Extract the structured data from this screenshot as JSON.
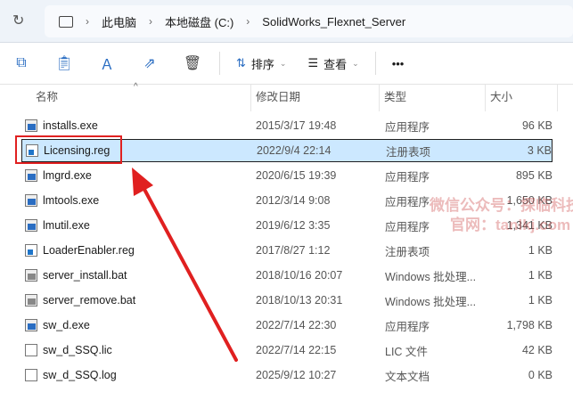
{
  "address": {
    "crumbs": [
      "此电脑",
      "本地磁盘 (C:)",
      "SolidWorks_Flexnet_Server"
    ]
  },
  "toolbar": {
    "sort_label": "排序",
    "view_label": "查看",
    "more_label": "•••"
  },
  "columns": [
    "名称",
    "修改日期",
    "类型",
    "大小"
  ],
  "files": [
    {
      "name": "installs.exe",
      "date": "2015/3/17 19:48",
      "type": "应用程序",
      "size": "96 KB",
      "icon": "exe"
    },
    {
      "name": "Licensing.reg",
      "date": "2022/9/4 22:14",
      "type": "注册表项",
      "size": "3 KB",
      "icon": "reg",
      "selected": true
    },
    {
      "name": "lmgrd.exe",
      "date": "2020/6/15 19:39",
      "type": "应用程序",
      "size": "895 KB",
      "icon": "exe"
    },
    {
      "name": "lmtools.exe",
      "date": "2012/3/14 9:08",
      "type": "应用程序",
      "size": "1,650 KB",
      "icon": "exe"
    },
    {
      "name": "lmutil.exe",
      "date": "2019/6/12 3:35",
      "type": "应用程序",
      "size": "1,341 KB",
      "icon": "exe"
    },
    {
      "name": "LoaderEnabler.reg",
      "date": "2017/8/27 1:12",
      "type": "注册表项",
      "size": "1 KB",
      "icon": "reg"
    },
    {
      "name": "server_install.bat",
      "date": "2018/10/16 20:07",
      "type": "Windows 批处理...",
      "size": "1 KB",
      "icon": "bat"
    },
    {
      "name": "server_remove.bat",
      "date": "2018/10/13 20:31",
      "type": "Windows 批处理...",
      "size": "1 KB",
      "icon": "bat"
    },
    {
      "name": "sw_d.exe",
      "date": "2022/7/14 22:30",
      "type": "应用程序",
      "size": "1,798 KB",
      "icon": "exe"
    },
    {
      "name": "sw_d_SSQ.lic",
      "date": "2022/7/14 22:15",
      "type": "LIC 文件",
      "size": "42 KB",
      "icon": "txt"
    },
    {
      "name": "sw_d_SSQ.log",
      "date": "2025/9/12 10:27",
      "type": "文本文档",
      "size": "0 KB",
      "icon": "txt"
    }
  ],
  "watermark": [
    "微信公众号：探临科技",
    "官网：tanlkj.com"
  ],
  "colors": {
    "selection": "#cce8ff",
    "annotation": "#e02020"
  }
}
